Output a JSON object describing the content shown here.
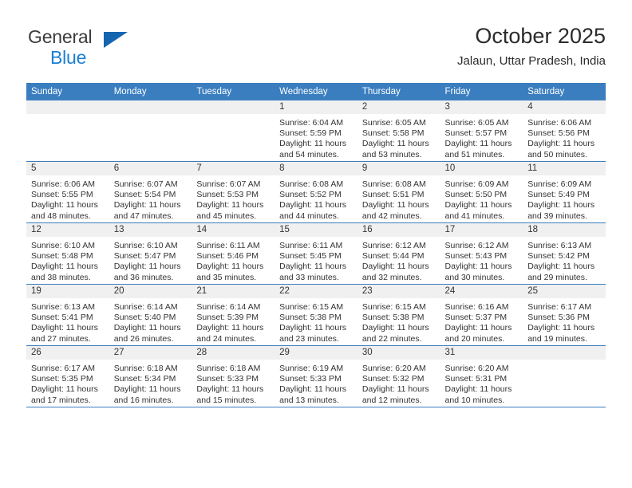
{
  "brand": {
    "word_one": "General",
    "word_two": "Blue",
    "triangle_icon": "triangle-icon"
  },
  "header": {
    "title": "October 2025",
    "subtitle": "Jalaun, Uttar Pradesh, India"
  },
  "colors": {
    "header_blue": "#3a7ebf",
    "brand_blue": "#1b7fd4",
    "daynum_bg": "#f0f0f0"
  },
  "weekday_headers": [
    "Sunday",
    "Monday",
    "Tuesday",
    "Wednesday",
    "Thursday",
    "Friday",
    "Saturday"
  ],
  "labels": {
    "sunrise_prefix": "Sunrise:",
    "sunset_prefix": "Sunset:",
    "daylight_prefix": "Daylight:"
  },
  "weeks": [
    [
      {
        "day": "",
        "empty": true
      },
      {
        "day": "",
        "empty": true
      },
      {
        "day": "",
        "empty": true
      },
      {
        "day": "1",
        "sunrise": "Sunrise: 6:04 AM",
        "sunset": "Sunset: 5:59 PM",
        "daylight": "Daylight: 11 hours and 54 minutes."
      },
      {
        "day": "2",
        "sunrise": "Sunrise: 6:05 AM",
        "sunset": "Sunset: 5:58 PM",
        "daylight": "Daylight: 11 hours and 53 minutes."
      },
      {
        "day": "3",
        "sunrise": "Sunrise: 6:05 AM",
        "sunset": "Sunset: 5:57 PM",
        "daylight": "Daylight: 11 hours and 51 minutes."
      },
      {
        "day": "4",
        "sunrise": "Sunrise: 6:06 AM",
        "sunset": "Sunset: 5:56 PM",
        "daylight": "Daylight: 11 hours and 50 minutes."
      }
    ],
    [
      {
        "day": "5",
        "sunrise": "Sunrise: 6:06 AM",
        "sunset": "Sunset: 5:55 PM",
        "daylight": "Daylight: 11 hours and 48 minutes."
      },
      {
        "day": "6",
        "sunrise": "Sunrise: 6:07 AM",
        "sunset": "Sunset: 5:54 PM",
        "daylight": "Daylight: 11 hours and 47 minutes."
      },
      {
        "day": "7",
        "sunrise": "Sunrise: 6:07 AM",
        "sunset": "Sunset: 5:53 PM",
        "daylight": "Daylight: 11 hours and 45 minutes."
      },
      {
        "day": "8",
        "sunrise": "Sunrise: 6:08 AM",
        "sunset": "Sunset: 5:52 PM",
        "daylight": "Daylight: 11 hours and 44 minutes."
      },
      {
        "day": "9",
        "sunrise": "Sunrise: 6:08 AM",
        "sunset": "Sunset: 5:51 PM",
        "daylight": "Daylight: 11 hours and 42 minutes."
      },
      {
        "day": "10",
        "sunrise": "Sunrise: 6:09 AM",
        "sunset": "Sunset: 5:50 PM",
        "daylight": "Daylight: 11 hours and 41 minutes."
      },
      {
        "day": "11",
        "sunrise": "Sunrise: 6:09 AM",
        "sunset": "Sunset: 5:49 PM",
        "daylight": "Daylight: 11 hours and 39 minutes."
      }
    ],
    [
      {
        "day": "12",
        "sunrise": "Sunrise: 6:10 AM",
        "sunset": "Sunset: 5:48 PM",
        "daylight": "Daylight: 11 hours and 38 minutes."
      },
      {
        "day": "13",
        "sunrise": "Sunrise: 6:10 AM",
        "sunset": "Sunset: 5:47 PM",
        "daylight": "Daylight: 11 hours and 36 minutes."
      },
      {
        "day": "14",
        "sunrise": "Sunrise: 6:11 AM",
        "sunset": "Sunset: 5:46 PM",
        "daylight": "Daylight: 11 hours and 35 minutes."
      },
      {
        "day": "15",
        "sunrise": "Sunrise: 6:11 AM",
        "sunset": "Sunset: 5:45 PM",
        "daylight": "Daylight: 11 hours and 33 minutes."
      },
      {
        "day": "16",
        "sunrise": "Sunrise: 6:12 AM",
        "sunset": "Sunset: 5:44 PM",
        "daylight": "Daylight: 11 hours and 32 minutes."
      },
      {
        "day": "17",
        "sunrise": "Sunrise: 6:12 AM",
        "sunset": "Sunset: 5:43 PM",
        "daylight": "Daylight: 11 hours and 30 minutes."
      },
      {
        "day": "18",
        "sunrise": "Sunrise: 6:13 AM",
        "sunset": "Sunset: 5:42 PM",
        "daylight": "Daylight: 11 hours and 29 minutes."
      }
    ],
    [
      {
        "day": "19",
        "sunrise": "Sunrise: 6:13 AM",
        "sunset": "Sunset: 5:41 PM",
        "daylight": "Daylight: 11 hours and 27 minutes."
      },
      {
        "day": "20",
        "sunrise": "Sunrise: 6:14 AM",
        "sunset": "Sunset: 5:40 PM",
        "daylight": "Daylight: 11 hours and 26 minutes."
      },
      {
        "day": "21",
        "sunrise": "Sunrise: 6:14 AM",
        "sunset": "Sunset: 5:39 PM",
        "daylight": "Daylight: 11 hours and 24 minutes."
      },
      {
        "day": "22",
        "sunrise": "Sunrise: 6:15 AM",
        "sunset": "Sunset: 5:38 PM",
        "daylight": "Daylight: 11 hours and 23 minutes."
      },
      {
        "day": "23",
        "sunrise": "Sunrise: 6:15 AM",
        "sunset": "Sunset: 5:38 PM",
        "daylight": "Daylight: 11 hours and 22 minutes."
      },
      {
        "day": "24",
        "sunrise": "Sunrise: 6:16 AM",
        "sunset": "Sunset: 5:37 PM",
        "daylight": "Daylight: 11 hours and 20 minutes."
      },
      {
        "day": "25",
        "sunrise": "Sunrise: 6:17 AM",
        "sunset": "Sunset: 5:36 PM",
        "daylight": "Daylight: 11 hours and 19 minutes."
      }
    ],
    [
      {
        "day": "26",
        "sunrise": "Sunrise: 6:17 AM",
        "sunset": "Sunset: 5:35 PM",
        "daylight": "Daylight: 11 hours and 17 minutes."
      },
      {
        "day": "27",
        "sunrise": "Sunrise: 6:18 AM",
        "sunset": "Sunset: 5:34 PM",
        "daylight": "Daylight: 11 hours and 16 minutes."
      },
      {
        "day": "28",
        "sunrise": "Sunrise: 6:18 AM",
        "sunset": "Sunset: 5:33 PM",
        "daylight": "Daylight: 11 hours and 15 minutes."
      },
      {
        "day": "29",
        "sunrise": "Sunrise: 6:19 AM",
        "sunset": "Sunset: 5:33 PM",
        "daylight": "Daylight: 11 hours and 13 minutes."
      },
      {
        "day": "30",
        "sunrise": "Sunrise: 6:20 AM",
        "sunset": "Sunset: 5:32 PM",
        "daylight": "Daylight: 11 hours and 12 minutes."
      },
      {
        "day": "31",
        "sunrise": "Sunrise: 6:20 AM",
        "sunset": "Sunset: 5:31 PM",
        "daylight": "Daylight: 11 hours and 10 minutes."
      },
      {
        "day": "",
        "empty": true
      }
    ]
  ]
}
